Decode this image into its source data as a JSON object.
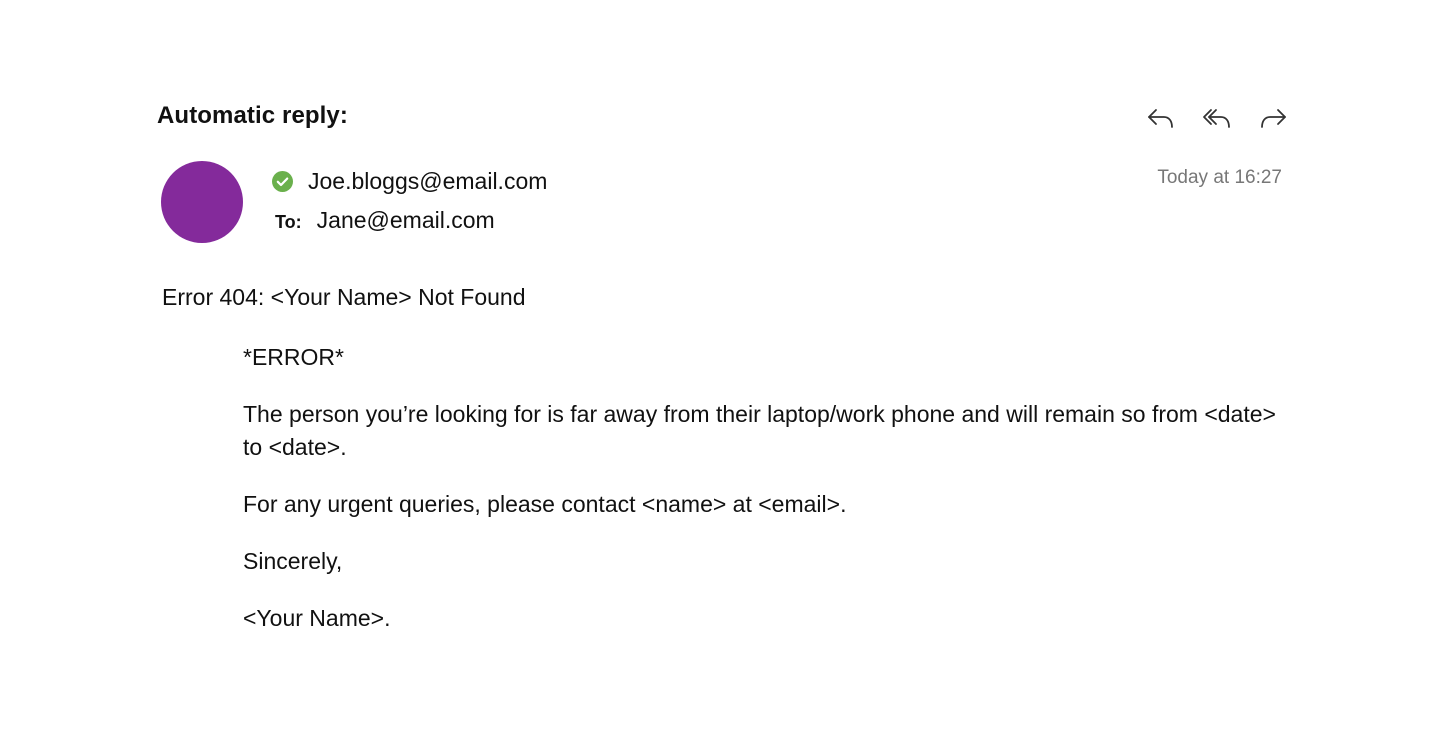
{
  "header": {
    "subject": "Automatic reply:",
    "actions": [
      {
        "name": "reply-button",
        "icon": "reply-icon"
      },
      {
        "name": "reply-all-button",
        "icon": "reply-all-icon"
      },
      {
        "name": "forward-button",
        "icon": "forward-icon"
      }
    ]
  },
  "sender": {
    "avatar_color": "#842a9b",
    "status_color": "#6ab04c",
    "status_icon": "check-circle-icon",
    "from": "Joe.bloggs@email.com",
    "to_label": "To:",
    "to": "Jane@email.com",
    "timestamp": "Today at 16:27"
  },
  "message": {
    "heading": "Error 404: <Your Name> Not Found",
    "paragraphs": [
      "*ERROR*",
      "The person you’re looking for is far away from their laptop/work phone and will remain so from <date> to <date>.",
      "For any urgent queries, please contact <name> at <email>.",
      "Sincerely,",
      "<Your Name>."
    ]
  }
}
